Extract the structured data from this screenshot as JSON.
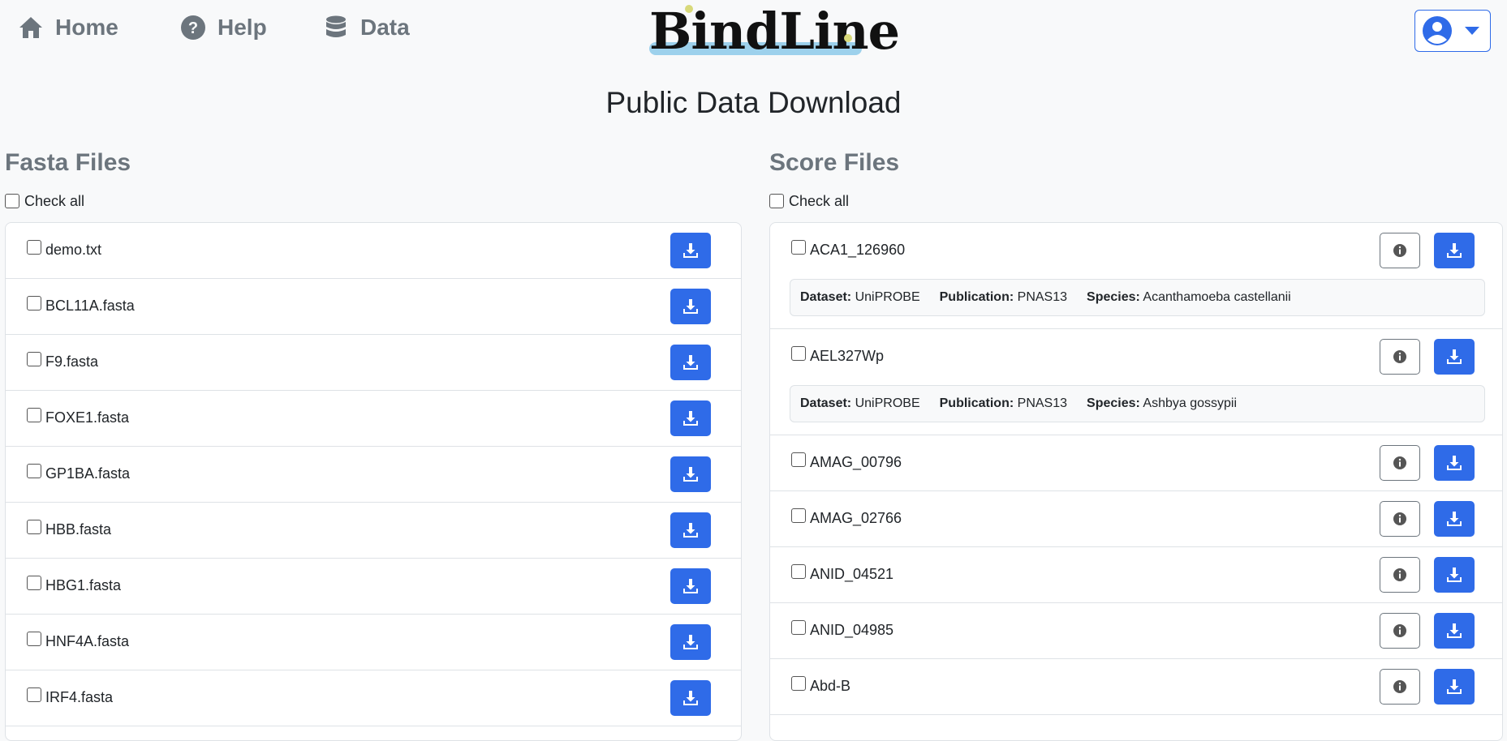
{
  "nav": {
    "home": "Home",
    "help": "Help",
    "data": "Data",
    "logo": "BindLine"
  },
  "page_title": "Public Data Download",
  "fasta": {
    "title": "Fasta Files",
    "check_all": "Check all",
    "files": [
      "demo.txt",
      "BCL11A.fasta",
      "F9.fasta",
      "FOXE1.fasta",
      "GP1BA.fasta",
      "HBB.fasta",
      "HBG1.fasta",
      "HNF4A.fasta",
      "IRF4.fasta"
    ]
  },
  "score": {
    "title": "Score Files",
    "check_all": "Check all",
    "labels": {
      "dataset": "Dataset:",
      "publication": "Publication:",
      "species": "Species:"
    },
    "files": [
      {
        "name": "ACA1_126960",
        "dataset": "UniPROBE",
        "publication": "PNAS13",
        "species": "Acanthamoeba castellanii"
      },
      {
        "name": "AEL327Wp",
        "dataset": "UniPROBE",
        "publication": "PNAS13",
        "species": "Ashbya gossypii"
      },
      {
        "name": "AMAG_00796"
      },
      {
        "name": "AMAG_02766"
      },
      {
        "name": "ANID_04521"
      },
      {
        "name": "ANID_04985"
      },
      {
        "name": "Abd-B"
      }
    ]
  },
  "colors": {
    "primary": "#2f6be8",
    "muted": "#6c757d",
    "background": "#f8f9fa"
  },
  "icons": {
    "home": "home-icon",
    "help": "question-circle-icon",
    "data": "database-icon",
    "user": "user-circle-icon",
    "download": "download-icon",
    "info": "info-icon"
  }
}
